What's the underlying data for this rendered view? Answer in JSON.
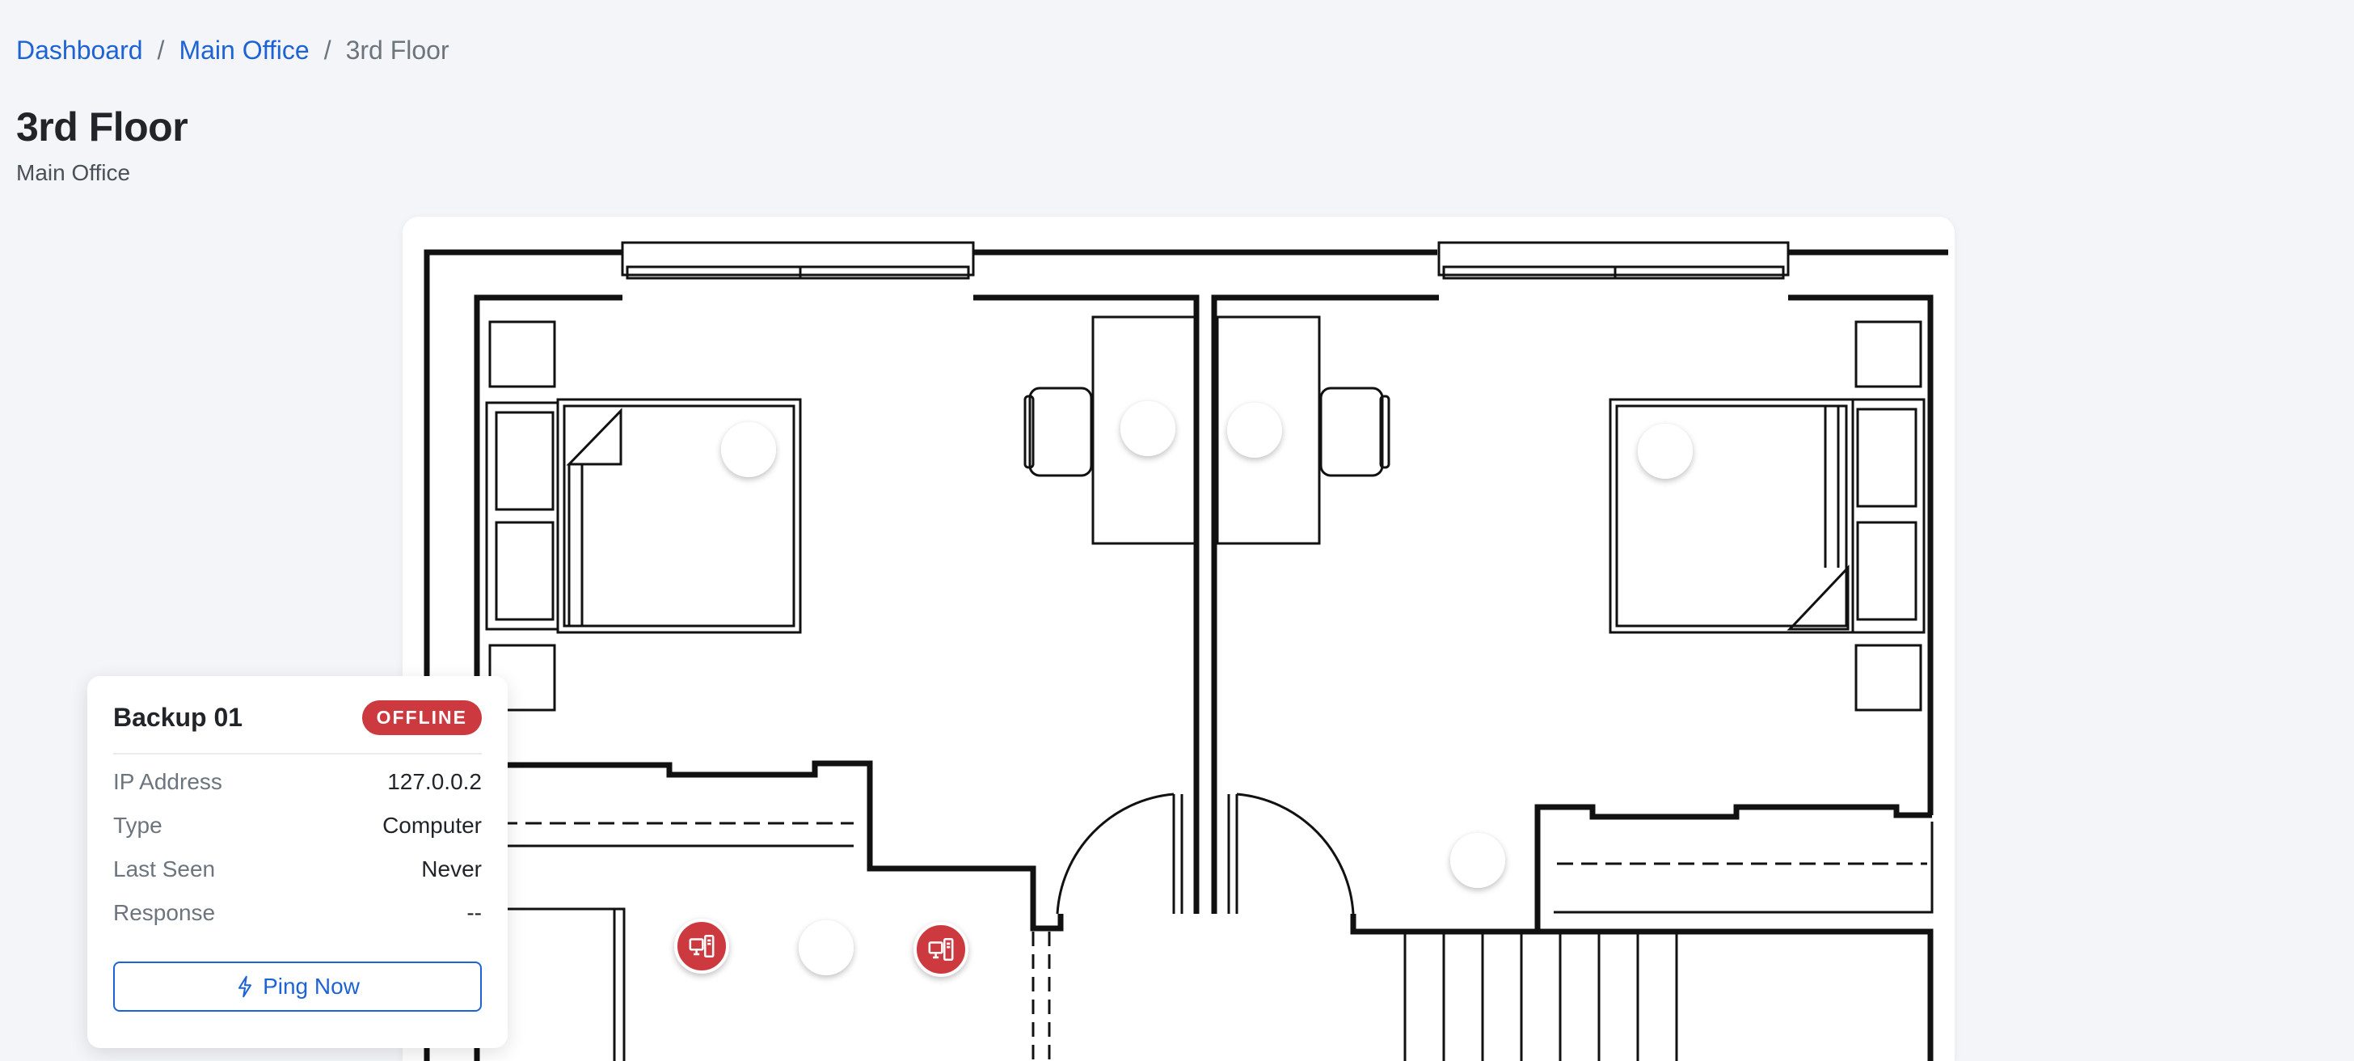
{
  "breadcrumb": {
    "items": [
      {
        "label": "Dashboard"
      },
      {
        "label": "Main Office"
      }
    ],
    "current": "3rd Floor",
    "separator": "/"
  },
  "page": {
    "title": "3rd Floor",
    "subtitle": "Main Office"
  },
  "colors": {
    "online": "#4caf50",
    "offline": "#cc3a40",
    "link": "#1d63d6"
  },
  "markers": [
    {
      "icon": "printer-icon",
      "status": "online"
    },
    {
      "icon": "computer-icon",
      "status": "online"
    },
    {
      "icon": "computer-icon",
      "status": "online"
    },
    {
      "icon": "printer-icon",
      "status": "online"
    },
    {
      "icon": "wifi-icon",
      "status": "online"
    },
    {
      "icon": "computer-icon",
      "status": "offline"
    },
    {
      "icon": "computer-icon",
      "status": "online"
    },
    {
      "icon": "computer-icon",
      "status": "offline"
    }
  ],
  "popup": {
    "device_name": "Backup 01",
    "status_badge": "OFFLINE",
    "fields": [
      {
        "label": "IP Address",
        "value": "127.0.0.2"
      },
      {
        "label": "Type",
        "value": "Computer"
      },
      {
        "label": "Last Seen",
        "value": "Never"
      },
      {
        "label": "Response",
        "value": "--"
      }
    ],
    "ping_label": "Ping Now",
    "ping_icon": "lightning-icon"
  }
}
